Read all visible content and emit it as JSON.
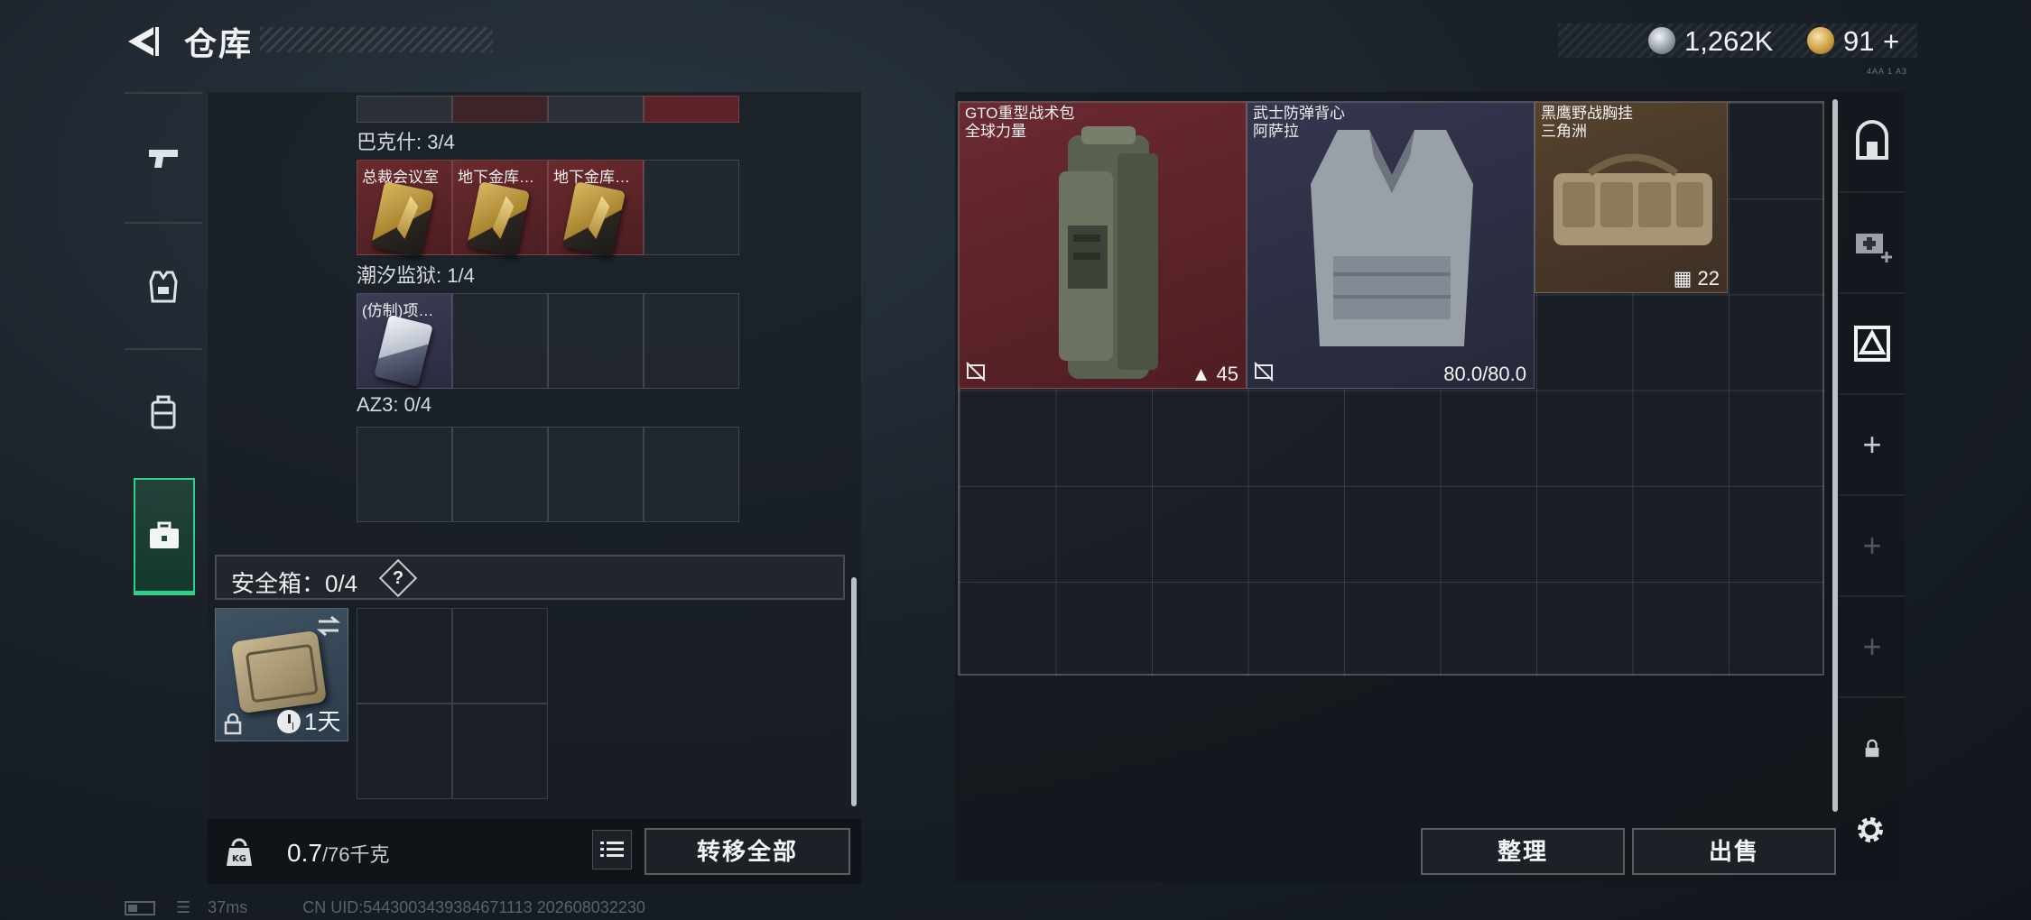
{
  "header": {
    "title": "仓库",
    "currency_silver": "1,262K",
    "currency_gold": "91",
    "currency_gold_plus": "+",
    "version_tag": "4AA 1 A3"
  },
  "sidebar": {
    "tabs": [
      {
        "icon": "pistol-icon",
        "active": false
      },
      {
        "icon": "vest-icon",
        "active": false
      },
      {
        "icon": "backpack-icon",
        "active": false
      },
      {
        "icon": "case-icon",
        "active": true
      }
    ]
  },
  "container": {
    "sections": [
      {
        "label": "巴克什: 3/4",
        "slots": [
          "总裁会议室",
          "地下金库…",
          "地下金库…",
          ""
        ]
      },
      {
        "label": "潮汐监狱: 1/4",
        "slots": [
          "(仿制)项…",
          "",
          "",
          ""
        ]
      },
      {
        "label": "AZ3: 0/4",
        "slots": [
          "",
          "",
          "",
          ""
        ]
      }
    ],
    "safe_box": {
      "title": "安全箱：0/4",
      "help": "?",
      "timer": "1天"
    }
  },
  "footer_left": {
    "weight_current": "0.7",
    "weight_max": "/76千克",
    "transfer_all": "转移全部"
  },
  "stash": {
    "items": [
      {
        "name": "GTO重型战术包",
        "sub": "全球力量",
        "stat": "45",
        "rarity_color": "#5b2329"
      },
      {
        "name": "武士防弹背心",
        "sub": "阿萨拉",
        "stat": "80.0/80.0",
        "rarity_color": "#2f3247"
      },
      {
        "name": "黑鹰野战胸挂",
        "sub": "三角洲",
        "stat": "22",
        "rarity_color": "#4a3a2c"
      }
    ],
    "organize": "整理",
    "sell": "出售"
  },
  "right_rail": {
    "plus": "+"
  },
  "status": {
    "ping": "37ms",
    "uid": "CN UID:5443003439384671113 202608032230"
  }
}
